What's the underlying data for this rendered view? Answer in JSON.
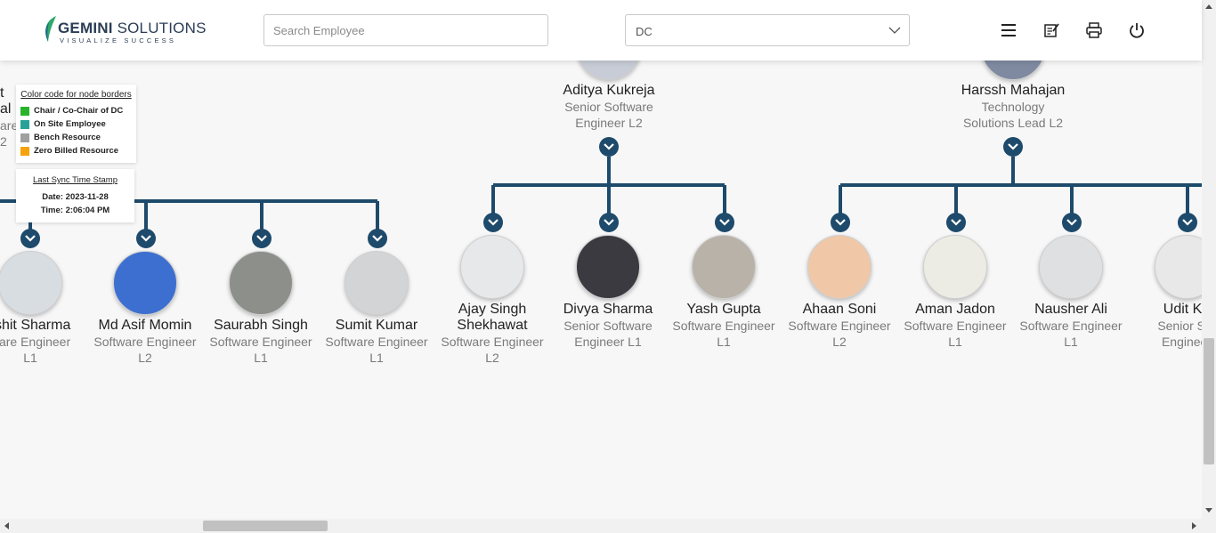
{
  "header": {
    "logo_text_bold": "GEMINI",
    "logo_text_rest": " SOLUTIONS",
    "logo_tagline": "VISUALIZE SUCCESS",
    "search_placeholder": "Search Employee",
    "select_value": "DC",
    "icons": [
      "menu-icon",
      "notes-icon",
      "print-icon",
      "power-icon"
    ]
  },
  "legend": {
    "title": "Color code for node borders",
    "items": [
      {
        "label": "Chair / Co-Chair of DC",
        "color": "#28b32a"
      },
      {
        "label": "On Site Employee",
        "color": "#2aa198"
      },
      {
        "label": "Bench Resource",
        "color": "#a0a0a0"
      },
      {
        "label": "Zero Billed Resource",
        "color": "#f5a30c"
      }
    ]
  },
  "sync": {
    "title": "Last Sync Time Stamp",
    "date": "Date: 2023-11-28",
    "time": "Time: 2:06:04 PM"
  },
  "partial_left": {
    "l1": "t",
    "l2": "al",
    "l3": "are",
    "l4": "2"
  },
  "managers": [
    {
      "name": "Aditya Kukreja",
      "d1": "Senior Software",
      "d2": "Engineer L2"
    },
    {
      "name": "Harssh Mahajan",
      "d1": "Technology",
      "d2": "Solutions Lead L2"
    }
  ],
  "row1": [
    {
      "name": "rshit Sharma",
      "d1": "ware Engineer",
      "d2": "L1"
    },
    {
      "name": "Md Asif Momin",
      "d1": "Software Engineer",
      "d2": "L2"
    },
    {
      "name": "Saurabh Singh",
      "d1": "Software Engineer",
      "d2": "L1"
    },
    {
      "name": "Sumit Kumar",
      "d1": "Software Engineer",
      "d2": "L1"
    }
  ],
  "row2": [
    {
      "name": "Ajay Singh",
      "name2": "Shekhawat",
      "d1": "Software Engineer",
      "d2": "L2"
    },
    {
      "name": "Divya Sharma",
      "d1": "Senior Software",
      "d2": "Engineer L1"
    },
    {
      "name": "Yash Gupta",
      "d1": "Software Engineer",
      "d2": "L1"
    },
    {
      "name": "Ahaan Soni",
      "d1": "Software Engineer",
      "d2": "L2"
    },
    {
      "name": "Aman Jadon",
      "d1": "Software Engineer",
      "d2": "L1"
    },
    {
      "name": "Nausher Ali",
      "d1": "Software Engineer",
      "d2": "L1"
    },
    {
      "name": "Udit Ka",
      "d1": "Senior Sof",
      "d2": "Engineer"
    }
  ]
}
